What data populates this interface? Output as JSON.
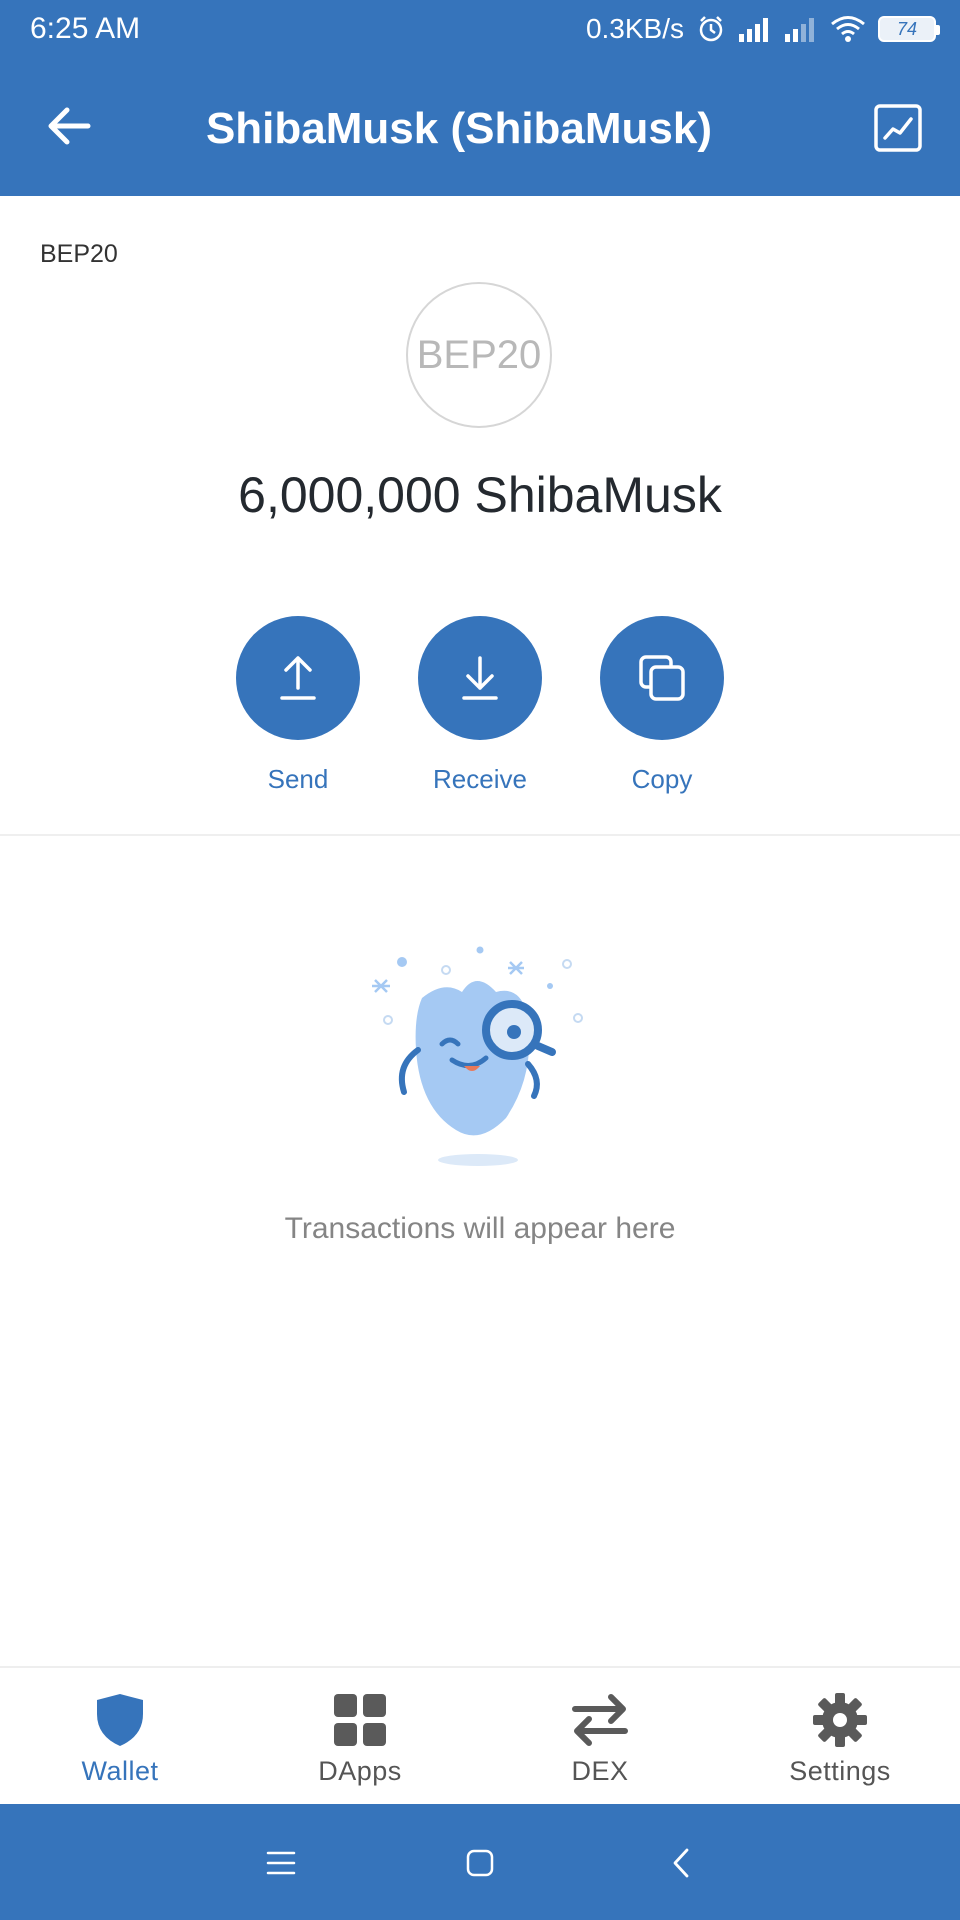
{
  "status_bar": {
    "time": "6:25 AM",
    "net_speed": "0.3KB/s",
    "battery": "74",
    "icons": [
      "alarm-icon",
      "signal-icon",
      "signal-icon",
      "wifi-icon",
      "battery-icon"
    ]
  },
  "header": {
    "title": "ShibaMusk (ShibaMusk)",
    "back_icon": "arrow-left-icon",
    "chart_icon": "line-chart-icon"
  },
  "token": {
    "network": "BEP20",
    "logo_text": "BEP20",
    "balance": "6,000,000 ShibaMusk"
  },
  "actions": [
    {
      "label": "Send",
      "icon": "upload-icon"
    },
    {
      "label": "Receive",
      "icon": "download-icon"
    },
    {
      "label": "Copy",
      "icon": "copy-icon"
    }
  ],
  "empty_state": {
    "message": "Transactions will appear here",
    "illustration": "mascot-magnifier-illustration"
  },
  "bottom_nav": [
    {
      "label": "Wallet",
      "icon": "shield-icon",
      "active": true
    },
    {
      "label": "DApps",
      "icon": "grid-icon",
      "active": false
    },
    {
      "label": "DEX",
      "icon": "swap-arrows-icon",
      "active": false
    },
    {
      "label": "Settings",
      "icon": "gear-icon",
      "active": false
    }
  ],
  "system_nav": [
    "menu-icon",
    "home-icon",
    "back-icon"
  ],
  "colors": {
    "primary": "#3674BB",
    "mascot": "#A5C9F3"
  }
}
